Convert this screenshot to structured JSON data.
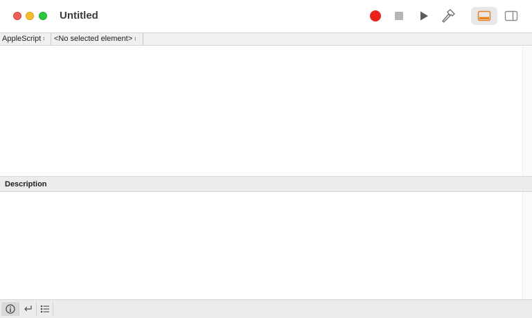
{
  "window": {
    "title": "Untitled"
  },
  "toolbar": {
    "icons": {
      "record": "record-icon",
      "stop": "stop-icon",
      "run": "run-icon",
      "compile": "hammer-icon",
      "bottom_pane": "bottom-pane-icon",
      "side_pane": "sidebar-icon"
    },
    "colors": {
      "record": "#e8231e",
      "accent": "#e8821e"
    }
  },
  "navbar": {
    "language": "AppleScript",
    "element": "<No selected element>",
    "updown_glyph": "↕"
  },
  "editor": {
    "content": ""
  },
  "description": {
    "header": "Description",
    "content": ""
  },
  "bottombar": {
    "icons": [
      "info-icon",
      "return-icon",
      "list-icon"
    ]
  }
}
